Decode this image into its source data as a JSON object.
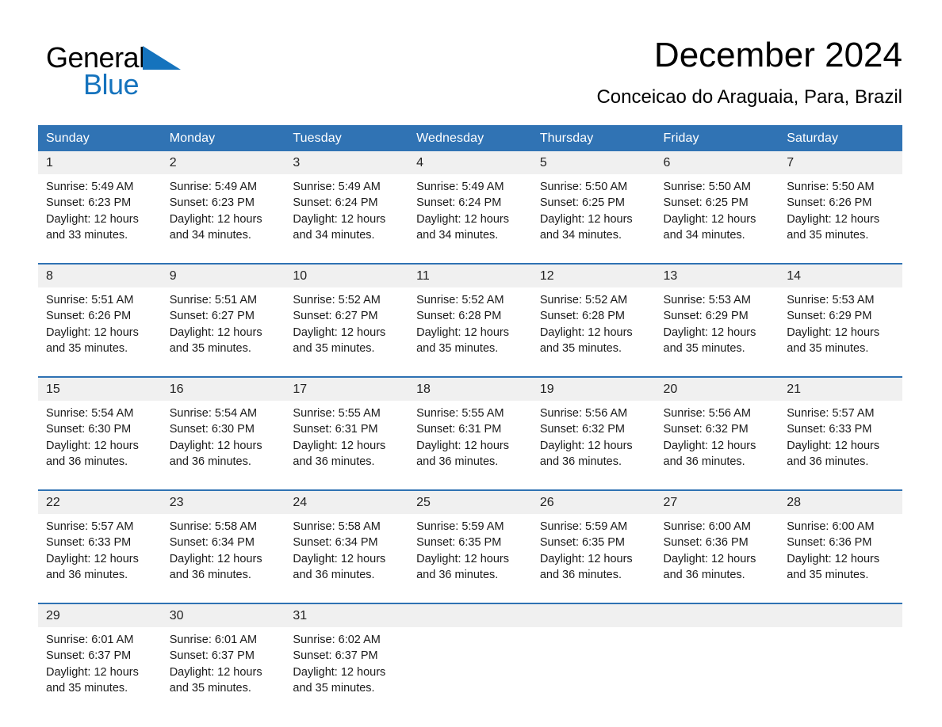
{
  "brand": {
    "name_part1": "General",
    "name_part2": "Blue",
    "triangle_color": "#1573bd"
  },
  "header": {
    "title": "December 2024",
    "subtitle": "Conceicao do Araguaia, Para, Brazil"
  },
  "theme": {
    "header_blue": "#3073b4",
    "separator_blue": "#2f72b3",
    "daynum_band": "#f0f0f0",
    "text": "#1a1a1a",
    "page_bg": "#ffffff"
  },
  "weekday_headers": [
    "Sunday",
    "Monday",
    "Tuesday",
    "Wednesday",
    "Thursday",
    "Friday",
    "Saturday"
  ],
  "weeks": [
    {
      "days": [
        {
          "num": "1",
          "l1": "Sunrise: 5:49 AM",
          "l2": "Sunset: 6:23 PM",
          "l3": "Daylight: 12 hours",
          "l4": "and 33 minutes."
        },
        {
          "num": "2",
          "l1": "Sunrise: 5:49 AM",
          "l2": "Sunset: 6:23 PM",
          "l3": "Daylight: 12 hours",
          "l4": "and 34 minutes."
        },
        {
          "num": "3",
          "l1": "Sunrise: 5:49 AM",
          "l2": "Sunset: 6:24 PM",
          "l3": "Daylight: 12 hours",
          "l4": "and 34 minutes."
        },
        {
          "num": "4",
          "l1": "Sunrise: 5:49 AM",
          "l2": "Sunset: 6:24 PM",
          "l3": "Daylight: 12 hours",
          "l4": "and 34 minutes."
        },
        {
          "num": "5",
          "l1": "Sunrise: 5:50 AM",
          "l2": "Sunset: 6:25 PM",
          "l3": "Daylight: 12 hours",
          "l4": "and 34 minutes."
        },
        {
          "num": "6",
          "l1": "Sunrise: 5:50 AM",
          "l2": "Sunset: 6:25 PM",
          "l3": "Daylight: 12 hours",
          "l4": "and 34 minutes."
        },
        {
          "num": "7",
          "l1": "Sunrise: 5:50 AM",
          "l2": "Sunset: 6:26 PM",
          "l3": "Daylight: 12 hours",
          "l4": "and 35 minutes."
        }
      ]
    },
    {
      "days": [
        {
          "num": "8",
          "l1": "Sunrise: 5:51 AM",
          "l2": "Sunset: 6:26 PM",
          "l3": "Daylight: 12 hours",
          "l4": "and 35 minutes."
        },
        {
          "num": "9",
          "l1": "Sunrise: 5:51 AM",
          "l2": "Sunset: 6:27 PM",
          "l3": "Daylight: 12 hours",
          "l4": "and 35 minutes."
        },
        {
          "num": "10",
          "l1": "Sunrise: 5:52 AM",
          "l2": "Sunset: 6:27 PM",
          "l3": "Daylight: 12 hours",
          "l4": "and 35 minutes."
        },
        {
          "num": "11",
          "l1": "Sunrise: 5:52 AM",
          "l2": "Sunset: 6:28 PM",
          "l3": "Daylight: 12 hours",
          "l4": "and 35 minutes."
        },
        {
          "num": "12",
          "l1": "Sunrise: 5:52 AM",
          "l2": "Sunset: 6:28 PM",
          "l3": "Daylight: 12 hours",
          "l4": "and 35 minutes."
        },
        {
          "num": "13",
          "l1": "Sunrise: 5:53 AM",
          "l2": "Sunset: 6:29 PM",
          "l3": "Daylight: 12 hours",
          "l4": "and 35 minutes."
        },
        {
          "num": "14",
          "l1": "Sunrise: 5:53 AM",
          "l2": "Sunset: 6:29 PM",
          "l3": "Daylight: 12 hours",
          "l4": "and 35 minutes."
        }
      ]
    },
    {
      "days": [
        {
          "num": "15",
          "l1": "Sunrise: 5:54 AM",
          "l2": "Sunset: 6:30 PM",
          "l3": "Daylight: 12 hours",
          "l4": "and 36 minutes."
        },
        {
          "num": "16",
          "l1": "Sunrise: 5:54 AM",
          "l2": "Sunset: 6:30 PM",
          "l3": "Daylight: 12 hours",
          "l4": "and 36 minutes."
        },
        {
          "num": "17",
          "l1": "Sunrise: 5:55 AM",
          "l2": "Sunset: 6:31 PM",
          "l3": "Daylight: 12 hours",
          "l4": "and 36 minutes."
        },
        {
          "num": "18",
          "l1": "Sunrise: 5:55 AM",
          "l2": "Sunset: 6:31 PM",
          "l3": "Daylight: 12 hours",
          "l4": "and 36 minutes."
        },
        {
          "num": "19",
          "l1": "Sunrise: 5:56 AM",
          "l2": "Sunset: 6:32 PM",
          "l3": "Daylight: 12 hours",
          "l4": "and 36 minutes."
        },
        {
          "num": "20",
          "l1": "Sunrise: 5:56 AM",
          "l2": "Sunset: 6:32 PM",
          "l3": "Daylight: 12 hours",
          "l4": "and 36 minutes."
        },
        {
          "num": "21",
          "l1": "Sunrise: 5:57 AM",
          "l2": "Sunset: 6:33 PM",
          "l3": "Daylight: 12 hours",
          "l4": "and 36 minutes."
        }
      ]
    },
    {
      "days": [
        {
          "num": "22",
          "l1": "Sunrise: 5:57 AM",
          "l2": "Sunset: 6:33 PM",
          "l3": "Daylight: 12 hours",
          "l4": "and 36 minutes."
        },
        {
          "num": "23",
          "l1": "Sunrise: 5:58 AM",
          "l2": "Sunset: 6:34 PM",
          "l3": "Daylight: 12 hours",
          "l4": "and 36 minutes."
        },
        {
          "num": "24",
          "l1": "Sunrise: 5:58 AM",
          "l2": "Sunset: 6:34 PM",
          "l3": "Daylight: 12 hours",
          "l4": "and 36 minutes."
        },
        {
          "num": "25",
          "l1": "Sunrise: 5:59 AM",
          "l2": "Sunset: 6:35 PM",
          "l3": "Daylight: 12 hours",
          "l4": "and 36 minutes."
        },
        {
          "num": "26",
          "l1": "Sunrise: 5:59 AM",
          "l2": "Sunset: 6:35 PM",
          "l3": "Daylight: 12 hours",
          "l4": "and 36 minutes."
        },
        {
          "num": "27",
          "l1": "Sunrise: 6:00 AM",
          "l2": "Sunset: 6:36 PM",
          "l3": "Daylight: 12 hours",
          "l4": "and 36 minutes."
        },
        {
          "num": "28",
          "l1": "Sunrise: 6:00 AM",
          "l2": "Sunset: 6:36 PM",
          "l3": "Daylight: 12 hours",
          "l4": "and 35 minutes."
        }
      ]
    },
    {
      "days": [
        {
          "num": "29",
          "l1": "Sunrise: 6:01 AM",
          "l2": "Sunset: 6:37 PM",
          "l3": "Daylight: 12 hours",
          "l4": "and 35 minutes."
        },
        {
          "num": "30",
          "l1": "Sunrise: 6:01 AM",
          "l2": "Sunset: 6:37 PM",
          "l3": "Daylight: 12 hours",
          "l4": "and 35 minutes."
        },
        {
          "num": "31",
          "l1": "Sunrise: 6:02 AM",
          "l2": "Sunset: 6:37 PM",
          "l3": "Daylight: 12 hours",
          "l4": "and 35 minutes."
        },
        {
          "num": "",
          "l1": "",
          "l2": "",
          "l3": "",
          "l4": ""
        },
        {
          "num": "",
          "l1": "",
          "l2": "",
          "l3": "",
          "l4": ""
        },
        {
          "num": "",
          "l1": "",
          "l2": "",
          "l3": "",
          "l4": ""
        },
        {
          "num": "",
          "l1": "",
          "l2": "",
          "l3": "",
          "l4": ""
        }
      ]
    }
  ]
}
